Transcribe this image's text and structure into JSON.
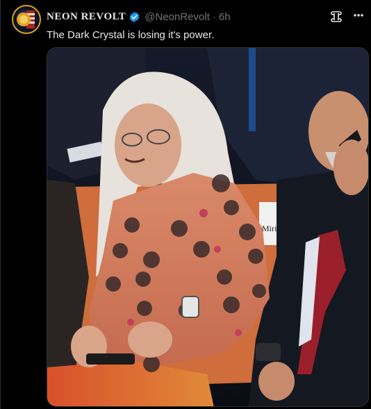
{
  "post": {
    "display_name": "NEON REVOLT",
    "handle": "@NeonRevolt",
    "separator": "·",
    "timestamp": "6h",
    "text": "The Dark Crystal is losing it's power."
  },
  "media": {
    "placard_text": "Miriam"
  },
  "icons": {
    "verified": "verified-badge-icon",
    "grok": "grok-icon",
    "more": "more-horizontal-icon"
  },
  "colors": {
    "verified": "#1d9bf0",
    "muted_text": "#71767b",
    "avatar_ring": "#d9a31c"
  }
}
